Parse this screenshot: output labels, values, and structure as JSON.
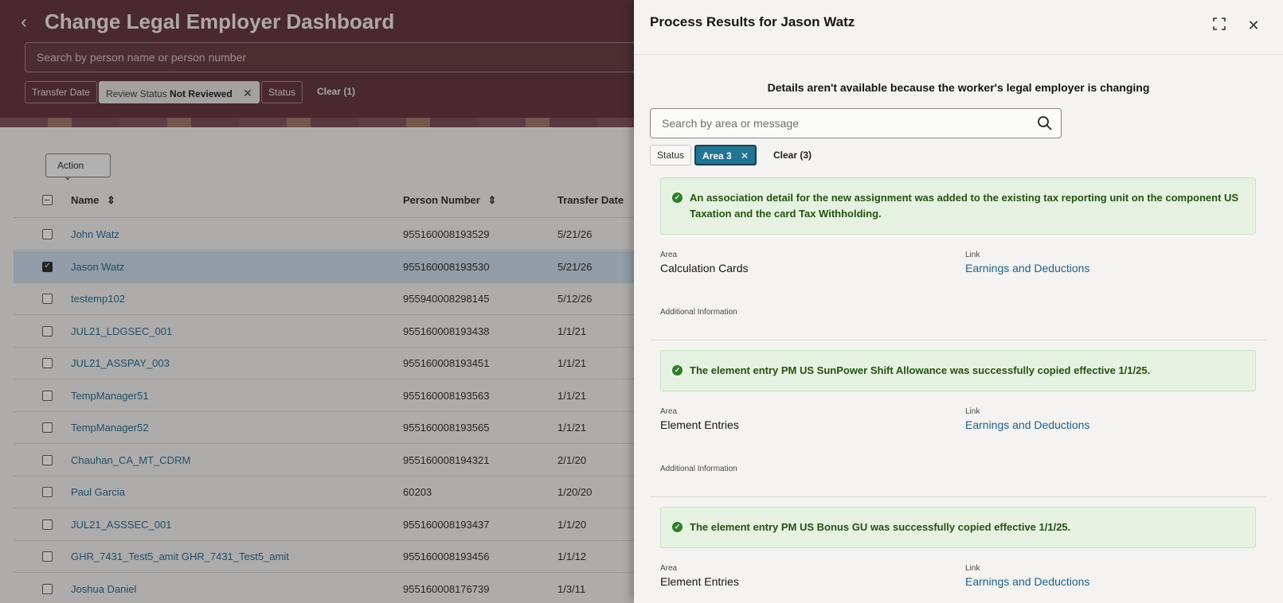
{
  "dashboard": {
    "title": "Change Legal Employer Dashboard",
    "search_placeholder": "Search by person name or person number",
    "filters": {
      "transfer_date": "Transfer Date",
      "review_status_label": "Review Status",
      "review_status_value": "Not Reviewed",
      "status": "Status",
      "clear": "Clear (1)"
    },
    "action_label": "Action",
    "columns": {
      "name": "Name",
      "person_number": "Person Number",
      "transfer_date": "Transfer Date"
    },
    "rows": [
      {
        "name": "John Watz",
        "person_number": "955160008193529",
        "transfer_date": "5/21/26",
        "selected": false
      },
      {
        "name": "Jason Watz",
        "person_number": "955160008193530",
        "transfer_date": "5/21/26",
        "selected": true
      },
      {
        "name": "testemp102",
        "person_number": "955940008298145",
        "transfer_date": "5/12/26",
        "selected": false
      },
      {
        "name": "JUL21_LDGSEC_001",
        "person_number": "955160008193438",
        "transfer_date": "1/1/21",
        "selected": false
      },
      {
        "name": "JUL21_ASSPAY_003",
        "person_number": "955160008193451",
        "transfer_date": "1/1/21",
        "selected": false
      },
      {
        "name": "TempManager51",
        "person_number": "955160008193563",
        "transfer_date": "1/1/21",
        "selected": false
      },
      {
        "name": "TempManager52",
        "person_number": "955160008193565",
        "transfer_date": "1/1/21",
        "selected": false
      },
      {
        "name": "Chauhan_CA_MT_CDRM",
        "person_number": "955160008194321",
        "transfer_date": "2/1/20",
        "selected": false
      },
      {
        "name": "Paul Garcia",
        "person_number": "60203",
        "transfer_date": "1/20/20",
        "selected": false
      },
      {
        "name": "JUL21_ASSSEC_001",
        "person_number": "955160008193437",
        "transfer_date": "1/1/20",
        "selected": false
      },
      {
        "name": "GHR_7431_Test5_amit GHR_7431_Test5_amit",
        "person_number": "955160008193456",
        "transfer_date": "1/1/12",
        "selected": false
      },
      {
        "name": "Joshua Daniel",
        "person_number": "955160008176739",
        "transfer_date": "1/3/11",
        "selected": false
      }
    ]
  },
  "drawer": {
    "title": "Process Results for Jason Watz",
    "notice": "Details aren't available because the worker's legal employer is changing",
    "search_placeholder": "Search by area or message",
    "filters": {
      "status": "Status",
      "area": "Area 3",
      "clear": "Clear (3)"
    },
    "labels": {
      "area": "Area",
      "link": "Link",
      "additional": "Additional Information"
    },
    "results": [
      {
        "message": "An association detail for the new assignment was added to the existing tax reporting unit on the component US Taxation and the card Tax Withholding.",
        "area": "Calculation Cards",
        "link": "Earnings and Deductions"
      },
      {
        "message": "The element entry PM US SunPower Shift Allowance was successfully copied effective 1/1/25.",
        "area": "Element Entries",
        "link": "Earnings and Deductions"
      },
      {
        "message": "The element entry PM US Bonus GU was successfully copied effective 1/1/25.",
        "area": "Element Entries",
        "link": "Earnings and Deductions"
      }
    ]
  },
  "icons": {
    "back": "chevron-left-icon",
    "expand": "expand-icon",
    "close": "close-icon",
    "search": "search-icon",
    "success": "check-circle-icon",
    "sort": "sort-icon"
  },
  "colors": {
    "header_bg": "#5a2a33",
    "link": "#1f6187",
    "success_bg": "#e6f2e1",
    "success_text": "#235212",
    "chip_active": "#227493"
  }
}
